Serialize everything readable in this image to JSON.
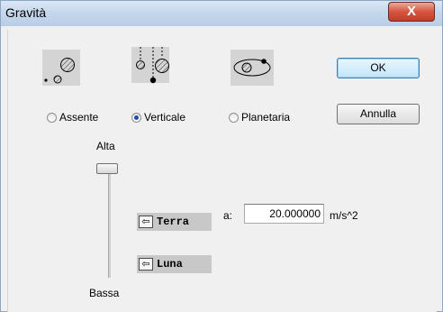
{
  "window": {
    "title": "Gravità",
    "close_label": "X"
  },
  "buttons": {
    "ok": "OK",
    "cancel": "Annulla"
  },
  "gravity_modes": [
    {
      "label": "Assente",
      "selected": false
    },
    {
      "label": "Verticale",
      "selected": true
    },
    {
      "label": "Planetaria",
      "selected": false
    }
  ],
  "slider": {
    "top_label": "Alta",
    "bottom_label": "Bassa",
    "level": 1.0
  },
  "presets": [
    {
      "label": "Terra",
      "icon": "arrow-left-icon"
    },
    {
      "label": "Luna",
      "icon": "arrow-left-icon"
    }
  ],
  "acceleration": {
    "label": "a:",
    "value": "20.000000",
    "unit": "m/s^2"
  },
  "colors": {
    "titlebar": "#c6d8ec",
    "close": "#c23d28",
    "selected_radio": "#1e4fa5"
  }
}
